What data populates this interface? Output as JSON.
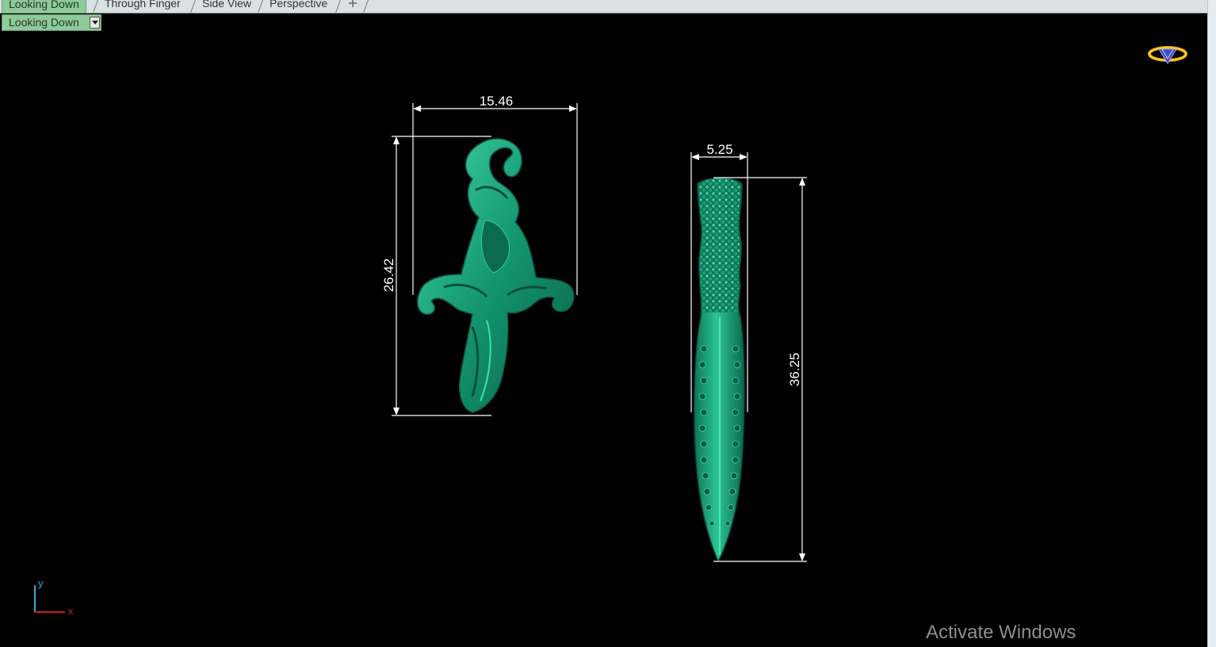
{
  "tabs": [
    {
      "label": "Looking Down",
      "active": true
    },
    {
      "label": "Through Finger",
      "active": false
    },
    {
      "label": "Side View",
      "active": false
    },
    {
      "label": "Perspective",
      "active": false
    }
  ],
  "add_tab_icon": "plus-icon",
  "view_selector": {
    "value": "Looking Down"
  },
  "dimensions": {
    "left_width": "15.46",
    "left_height": "26.42",
    "right_width": "5.25",
    "right_height": "36.25"
  },
  "axes": {
    "y": "y",
    "x": "x"
  },
  "logo_icon": "gem-ring-logo",
  "watermark": "Activate Windows",
  "colors": {
    "background": "#000000",
    "model_green": "#1aa07a",
    "tab_active": "#8fca9a"
  }
}
